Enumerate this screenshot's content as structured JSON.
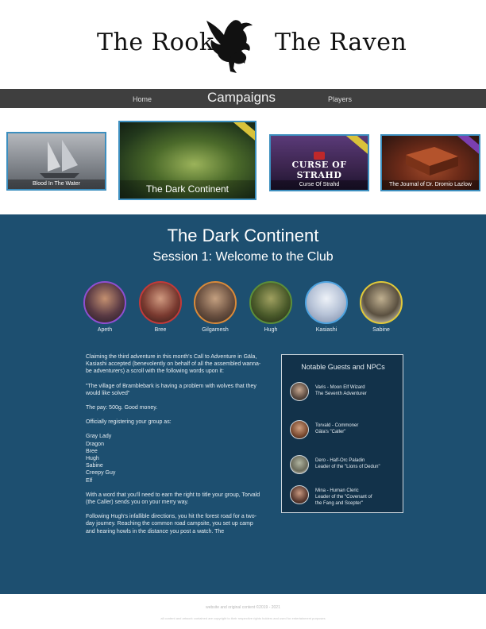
{
  "header": {
    "logo_left": "The Rook",
    "logo_right": "The Raven",
    "logo_icon": "raven-icon"
  },
  "nav": {
    "home": "Home",
    "campaigns": "Campaigns",
    "players": "Players"
  },
  "campaigns": [
    {
      "label": "Blood In The Water"
    },
    {
      "label": "The Dark Continent"
    },
    {
      "label": "Curse Of Strahd",
      "art_text": "CURSE OF STRAHD"
    },
    {
      "label": "The Journal of Dr. Dromio Lazlow"
    }
  ],
  "main": {
    "title": "The Dark Continent",
    "subtitle": "Session 1: Welcome to the Club"
  },
  "players": [
    {
      "name": "Apeth",
      "ring": "#8e4fd0"
    },
    {
      "name": "Bree",
      "ring": "#c23a3a"
    },
    {
      "name": "Gilgamesh",
      "ring": "#d98a3a"
    },
    {
      "name": "Hugh",
      "ring": "#5b8f3a"
    },
    {
      "name": "Kasiashi",
      "ring": "#4da3e0"
    },
    {
      "name": "Sabine",
      "ring": "#e0c93a"
    }
  ],
  "story": {
    "p1": "Claiming the third adventure in this month's Call to Adventure in Gäla, Kasiashi accepted (benevolently on behalf of all the assembled wanna-be adventurers) a scroll with the following words upon it:",
    "p2": "\"The village of Bramblebark is having a problem with wolves that they would like solved\"",
    "p3": "The pay: 500g. Good money.",
    "p4_intro": "Officially registering your group as:",
    "group_names": [
      "Gray Lady",
      "Dragon",
      "Bree",
      "Hugh",
      "Sabine",
      "Creepy Guy",
      "Elf"
    ],
    "p5": "With a word that you'll need to earn the right to title your group, Torvald (the Caller) sends you on your merry way.",
    "p6": "Following Hugh's infallible directions, you hit the forest road for a two-day journey. Reaching the common road campsite, you set up camp and hearing howls in the distance you post a watch. The"
  },
  "npcs": {
    "title": "Notable Guests and NPCs",
    "items": [
      {
        "line1": "Varis - Moon Elf Wizard",
        "line2": "The Seventh Adventurer",
        "line3": ""
      },
      {
        "line1": "Torvald - Commoner",
        "line2": "Gäla's \"Caller\"",
        "line3": ""
      },
      {
        "line1": "Dero - Half-Orc Paladin",
        "line2": "Leader of the \"Lions of Dedun\"",
        "line3": ""
      },
      {
        "line1": "Mina - Human Cleric",
        "line2": "Leader of the \"Covenant of",
        "line3": "the Fang and Scepter\""
      }
    ]
  },
  "footer": {
    "line1": "website and original content ©2019 - 2021",
    "line2": "all content and artwork contained are copyright to their respective rights holders and used for entertainment purposes"
  }
}
